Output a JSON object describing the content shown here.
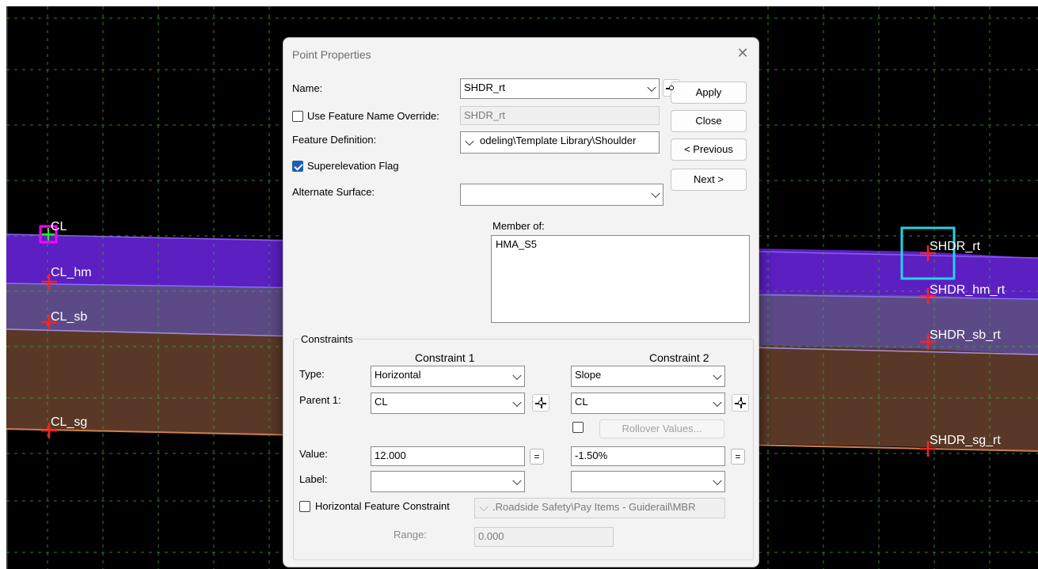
{
  "canvas": {
    "left_points": [
      "CL",
      "CL_hm",
      "CL_sb",
      "CL_sg"
    ],
    "right_points": [
      "SHDR_rt",
      "SHDR_hm_rt",
      "SHDR_sb_rt",
      "SHDR_sg_rt"
    ],
    "colors": {
      "background": "#000000",
      "asphalt": "#5b1fc2",
      "base": "#5c4a87",
      "subgrade": "#5a3827",
      "point_marker": "#ff2020",
      "selection": "#22d3e6",
      "active_point": "#ff00ff",
      "grid": "#2e8b2e"
    }
  },
  "dialog": {
    "title": "Point Properties",
    "close_glyph": "✕",
    "name_label": "Name:",
    "name_value": "SHDR_rt",
    "override_label": "Use Feature Name Override:",
    "override_value": "SHDR_rt",
    "override_checked": false,
    "feature_def_label": "Feature Definition:",
    "feature_def_value": "odeling\\Template Library\\Shoulder",
    "superelevation_label": "Superelevation Flag",
    "superelevation_checked": true,
    "alt_surface_label": "Alternate Surface:",
    "alt_surface_value": "",
    "member_of_label": "Member of:",
    "member_of_items": [
      "HMA_S5"
    ],
    "buttons": {
      "apply": "Apply",
      "close": "Close",
      "previous": "< Previous",
      "next": "Next >"
    },
    "constraints": {
      "group_label": "Constraints",
      "c1_header": "Constraint 1",
      "c2_header": "Constraint 2",
      "type_label": "Type:",
      "c1_type": "Horizontal",
      "c2_type": "Slope",
      "parent_label": "Parent 1:",
      "c1_parent": "CL",
      "c2_parent": "CL",
      "rollover_label": "Rollover Values...",
      "value_label": "Value:",
      "c1_value": "12.000",
      "c2_value": "-1.50%",
      "eq_label": "=",
      "label_label": "Label:",
      "c1_label_value": "",
      "c2_label_value": "",
      "hfc_label": "Horizontal Feature Constraint",
      "hfc_value": ".Roadside Safety\\Pay Items - Guiderail\\MBR",
      "range_label": "Range:",
      "range_value": "0.000"
    }
  }
}
